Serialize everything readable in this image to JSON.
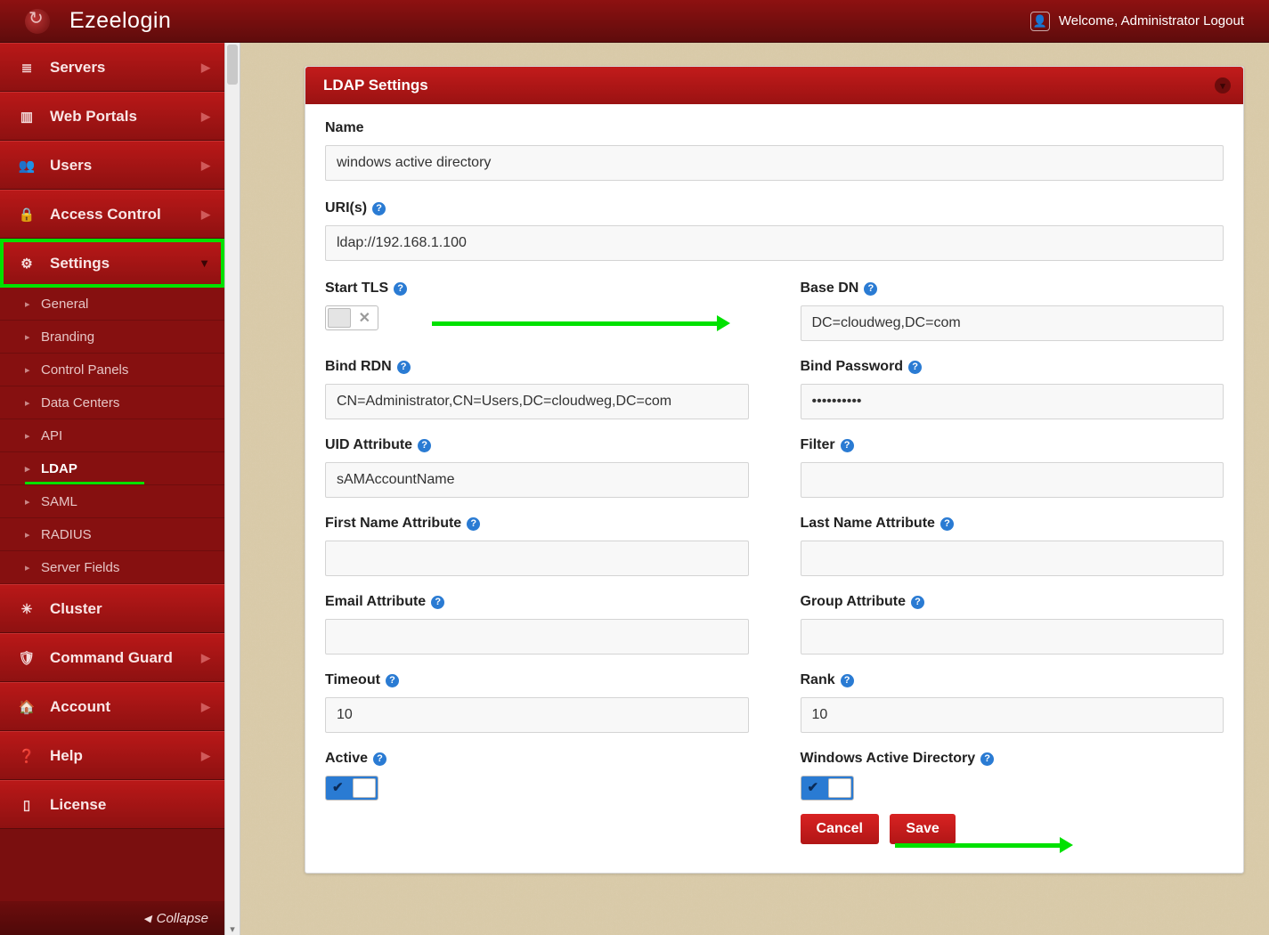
{
  "brand": "Ezeelogin",
  "header": {
    "welcome": "Welcome, Administrator Logout"
  },
  "sidebar": {
    "items": [
      {
        "label": "Servers"
      },
      {
        "label": "Web Portals"
      },
      {
        "label": "Users"
      },
      {
        "label": "Access Control"
      },
      {
        "label": "Settings"
      },
      {
        "label": "Cluster"
      },
      {
        "label": "Command Guard"
      },
      {
        "label": "Account"
      },
      {
        "label": "Help"
      },
      {
        "label": "License"
      }
    ],
    "settings_sub": [
      "General",
      "Branding",
      "Control Panels",
      "Data Centers",
      "API",
      "LDAP",
      "SAML",
      "RADIUS",
      "Server Fields"
    ],
    "collapse": "Collapse"
  },
  "panel": {
    "title": "LDAP Settings"
  },
  "form": {
    "name": {
      "label": "Name",
      "value": "windows active directory"
    },
    "uris": {
      "label": "URI(s)",
      "value": "ldap://192.168.1.100"
    },
    "start_tls": {
      "label": "Start TLS"
    },
    "base_dn": {
      "label": "Base DN",
      "value": "DC=cloudweg,DC=com"
    },
    "bind_rdn": {
      "label": "Bind RDN",
      "value": "CN=Administrator,CN=Users,DC=cloudweg,DC=com"
    },
    "bind_pw": {
      "label": "Bind Password",
      "value": "••••••••••"
    },
    "uid_attr": {
      "label": "UID Attribute",
      "value": "sAMAccountName"
    },
    "filter": {
      "label": "Filter",
      "value": ""
    },
    "first_name": {
      "label": "First Name Attribute",
      "value": ""
    },
    "last_name": {
      "label": "Last Name Attribute",
      "value": ""
    },
    "email_attr": {
      "label": "Email Attribute",
      "value": ""
    },
    "group_attr": {
      "label": "Group Attribute",
      "value": ""
    },
    "timeout": {
      "label": "Timeout",
      "value": "10"
    },
    "rank": {
      "label": "Rank",
      "value": "10"
    },
    "active": {
      "label": "Active"
    },
    "win_ad": {
      "label": "Windows Active Directory"
    },
    "cancel": "Cancel",
    "save": "Save"
  }
}
